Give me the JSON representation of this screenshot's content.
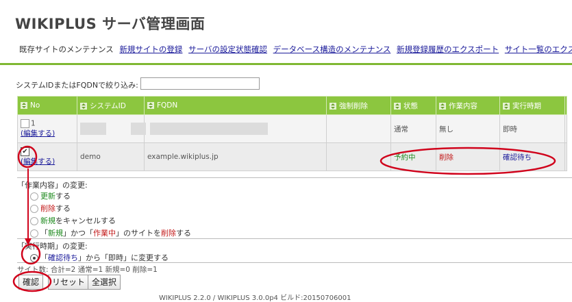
{
  "header": {
    "title": "WIKIPLUS サーバ管理画面"
  },
  "nav": {
    "items": [
      {
        "label": "既存サイトのメンテナンス",
        "link": false
      },
      {
        "label": "新規サイトの登録",
        "link": true
      },
      {
        "label": "サーバの設定状態確認",
        "link": true
      },
      {
        "label": "データベース構造のメンテナンス",
        "link": true
      },
      {
        "label": "新規登録履歴のエクスポート",
        "link": true
      },
      {
        "label": "サイト一覧のエクスポート",
        "link": true
      }
    ]
  },
  "filter": {
    "label": "システムIDまたはFQDNで絞り込み:",
    "value": ""
  },
  "table": {
    "headers": [
      "No",
      "システムID",
      "FQDN",
      "強制削除",
      "状態",
      "作業内容",
      "実行時期"
    ],
    "rows": [
      {
        "no": "1",
        "edit": "(編集する)",
        "system_id": "",
        "fqdn": "",
        "force": "",
        "status": "通常",
        "work": "無し",
        "timing": "即時",
        "checked": false
      },
      {
        "no": "2",
        "edit": "(編集する)",
        "system_id": "demo",
        "fqdn": "example.wikiplus.jp",
        "force": "",
        "status": "予約中",
        "work": "削除",
        "timing": "確認待ち",
        "checked": true
      }
    ]
  },
  "work_change": {
    "heading": "「作業内容」の変更:",
    "options": [
      {
        "prefix": "更新",
        "suffix": "する"
      },
      {
        "prefix": "削除",
        "suffix": "する"
      },
      {
        "prefix": "新規",
        "suffix": "をキャンセルする"
      },
      {
        "p1": "「",
        "k1": "新規",
        "p2": "」かつ「",
        "k2": "作業中",
        "p3": "」のサイトを",
        "k3": "削除",
        "p4": "する"
      }
    ]
  },
  "timing_change": {
    "heading": "「実行時期」の変更:",
    "option": {
      "k1": "確認待ち",
      "p1": "」から「即時」に変更する",
      "pre": "「"
    }
  },
  "summary": "サイト数: 合計=2 通常=1 新規=0 削除=1",
  "buttons": {
    "confirm": "確認",
    "reset": "リセット",
    "select_all": "全選択"
  },
  "footer": "WIKIPLUS 2.2.0 / WIKIPLUS 3.0.0p4 ビルド:20150706001",
  "colors": {
    "accent": "#8cc63f",
    "annotation": "#d0021b",
    "link": "#1a1a9a"
  }
}
